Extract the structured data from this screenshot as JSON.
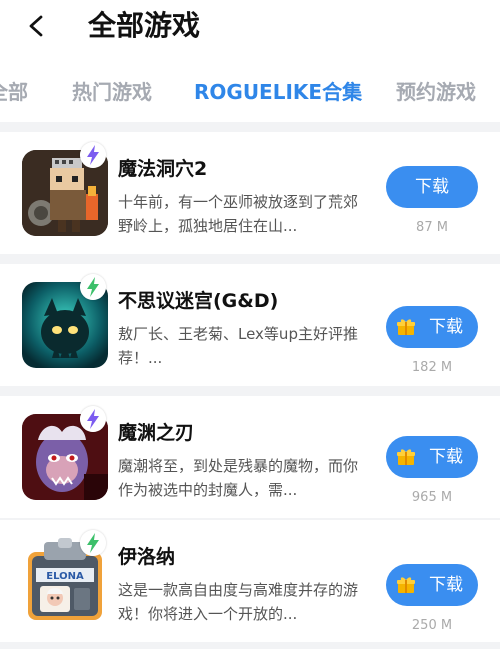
{
  "header": {
    "title": "全部游戏",
    "back_icon": "back-arrow-icon"
  },
  "tabs": [
    {
      "label": "全部",
      "active": false
    },
    {
      "label": "热门游戏",
      "active": false
    },
    {
      "label": "ROGUELIKE合集",
      "active": true
    },
    {
      "label": "预约游戏",
      "active": false
    }
  ],
  "games": [
    {
      "name": "魔法洞穴2",
      "desc": "十年前，有一个巫师被放逐到了荒郊野岭上，孤独地居住在山...",
      "button": "下载",
      "size": "87 M",
      "gift": false
    },
    {
      "name": "不思议迷宫(G&D)",
      "desc": "敖厂长、王老菊、Lex等up主好评推荐！...",
      "button": "下载",
      "size": "182 M",
      "gift": true
    },
    {
      "name": "魔渊之刃",
      "desc": "魔潮将至，到处是残暴的魔物，而你作为被选中的封魔人，需...",
      "button": "下载",
      "size": "965 M",
      "gift": true
    },
    {
      "name": "伊洛纳",
      "desc": "这是一款高自由度与高难度并存的游戏！你将进入一个开放的...",
      "button": "下载",
      "size": "250 M",
      "gift": true
    }
  ],
  "colors": {
    "accent": "#2f86e8",
    "button": "#3a8ef0",
    "badge": "#f5b400"
  },
  "icons": {
    "badge": "lightning-badge-icon",
    "gift": "gift-icon"
  },
  "icon_text": {
    "elona": "ELONA"
  }
}
